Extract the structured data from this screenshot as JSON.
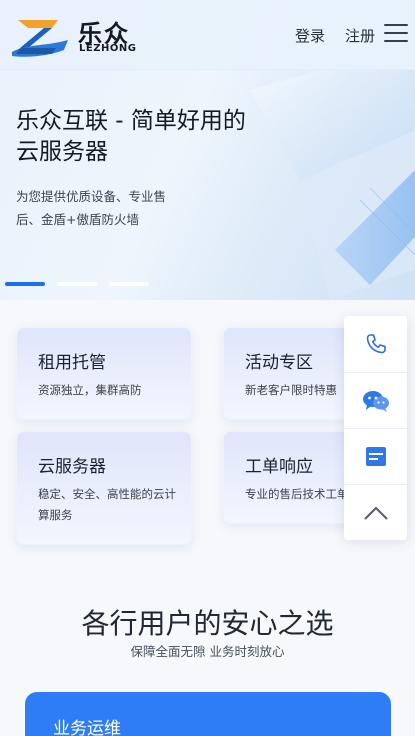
{
  "header": {
    "logo_cn": "乐众",
    "logo_en": "LEZHONG",
    "login": "登录",
    "register": "注册"
  },
  "banner": {
    "title": "乐众互联 - 简单好用的云服务器",
    "subtitle": "为您提供优质设备、专业售后、金盾+傲盾防火墙",
    "slides": 3,
    "active_slide": 1
  },
  "cards": [
    {
      "title": "租用托管",
      "desc": "资源独立，集群高防"
    },
    {
      "title": "活动专区",
      "desc": "新老客户限时特惠"
    },
    {
      "title": "云服务器",
      "desc": "稳定、安全、高性能的云计算服务"
    },
    {
      "title": "工单响应",
      "desc": "专业的售后技术工单"
    }
  ],
  "float_bar": [
    "phone-icon",
    "wechat-icon",
    "message-icon",
    "back-to-top-icon"
  ],
  "section": {
    "title": "各行用户的安心之选",
    "subtitle": "保障全面无隙 业务时刻放心",
    "card_title": "业务运维"
  },
  "colors": {
    "accent": "#1d6ff2",
    "card_blue": "#2f7df6"
  }
}
